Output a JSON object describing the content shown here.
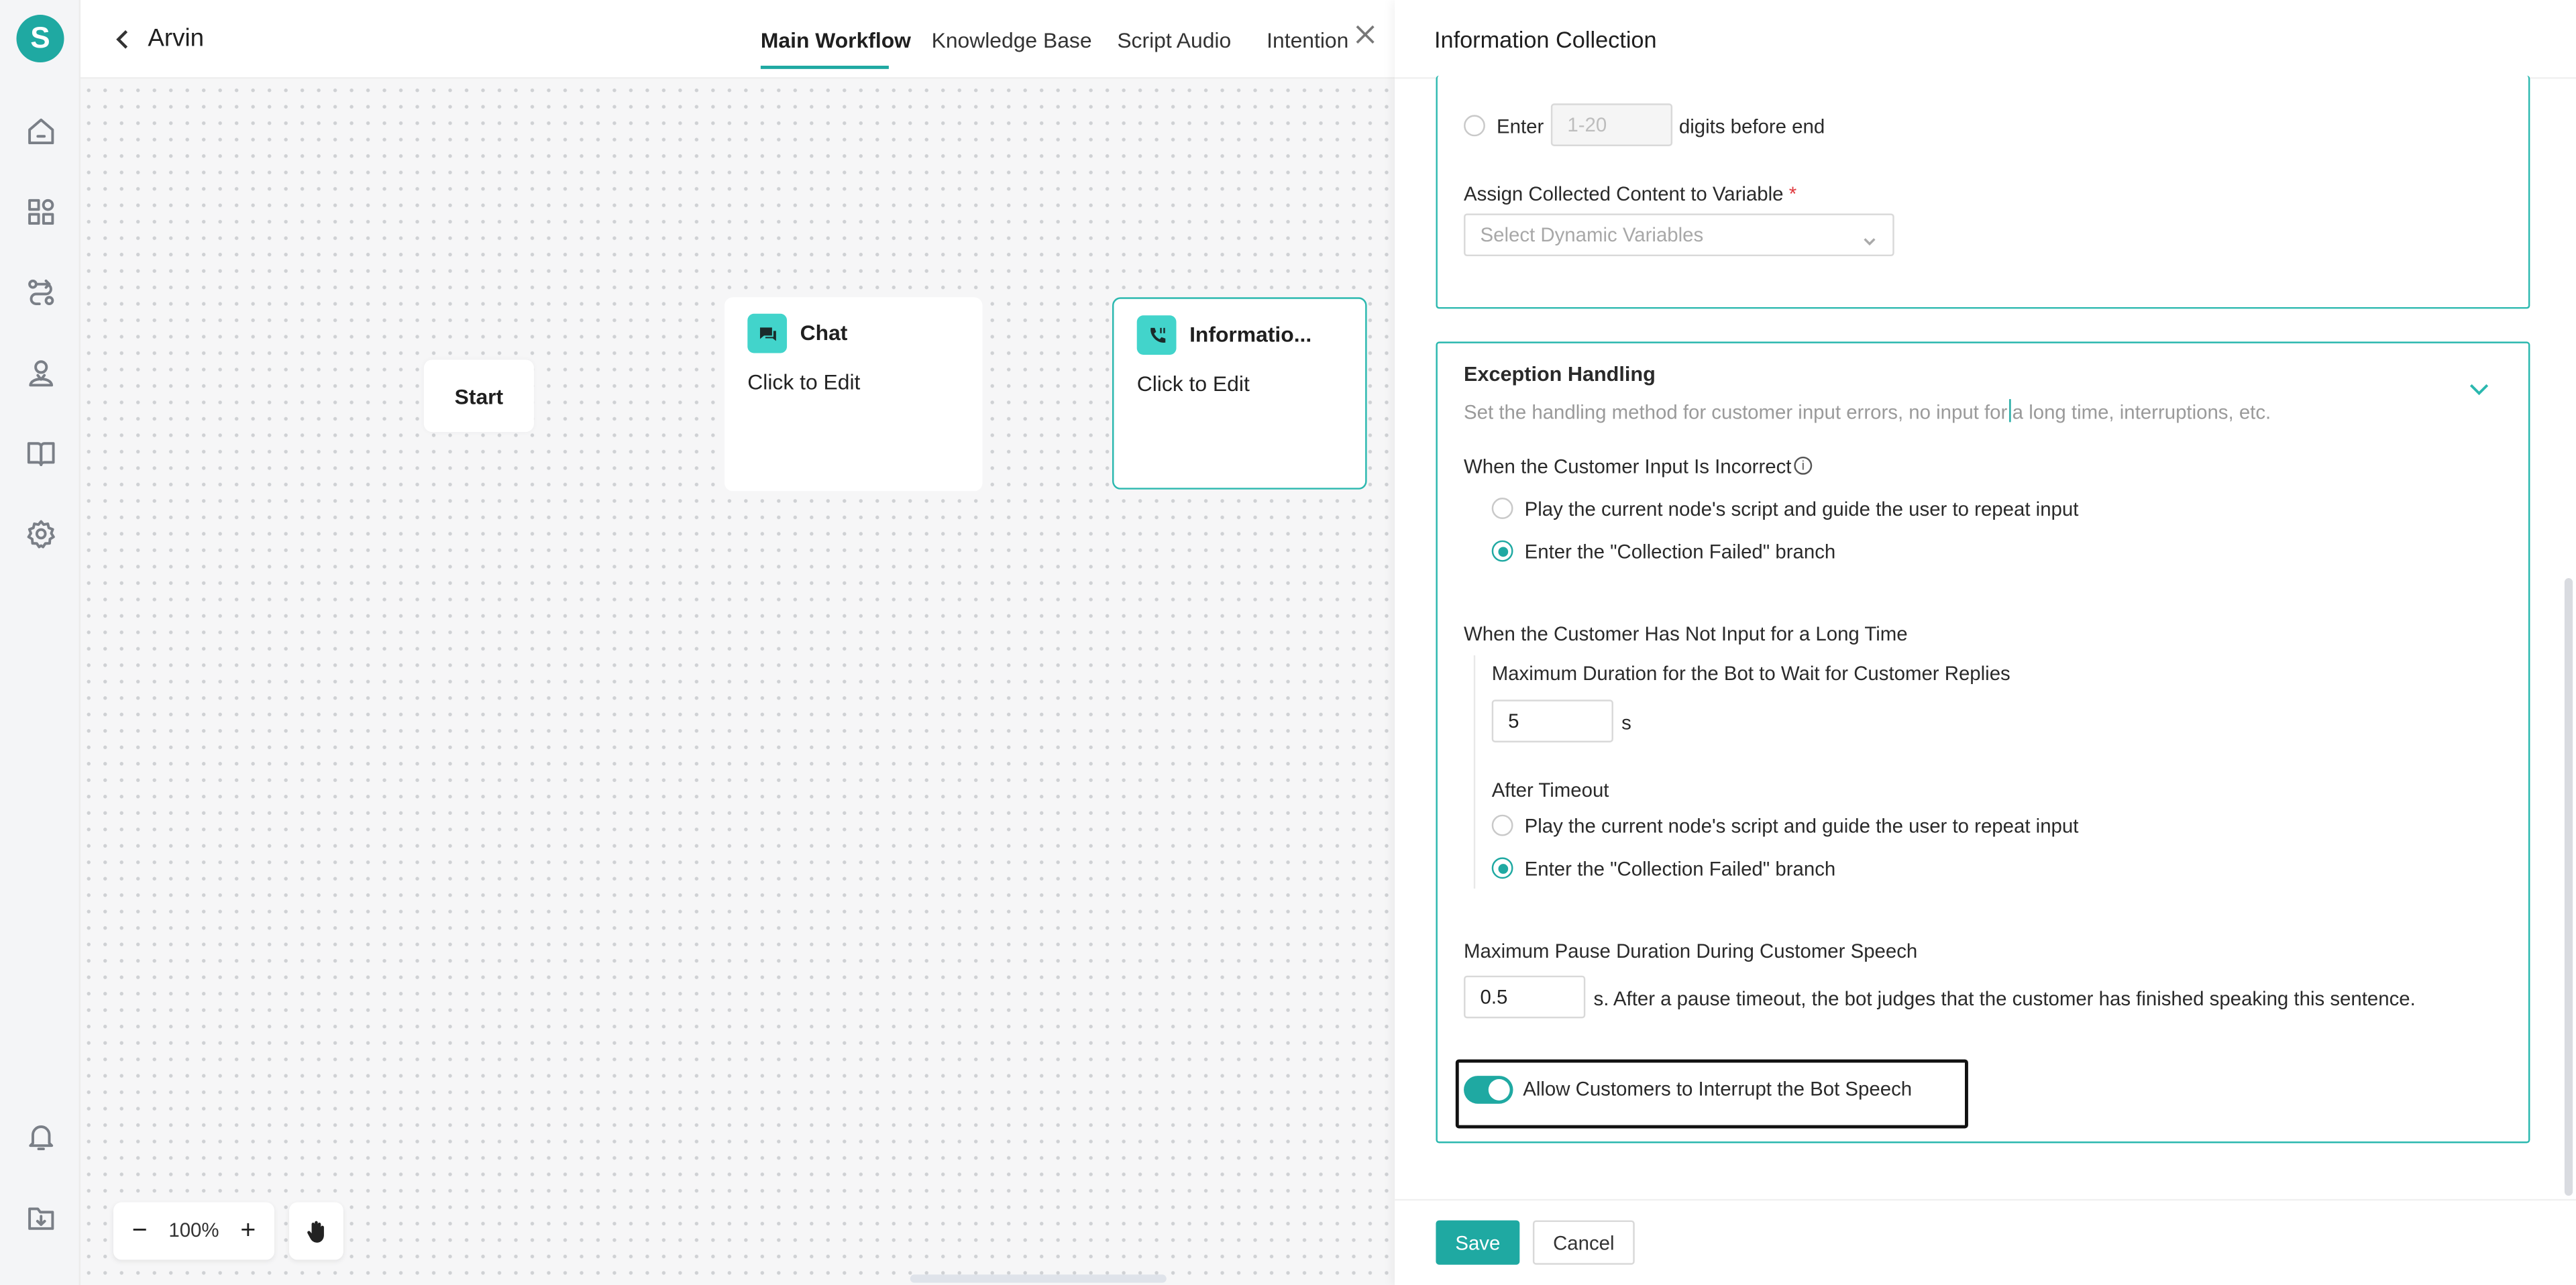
{
  "sidebar": {
    "logo_letter": "S",
    "items": [
      {
        "name": "home-icon"
      },
      {
        "name": "apps-icon"
      },
      {
        "name": "workflow-icon"
      },
      {
        "name": "agent-icon"
      },
      {
        "name": "book-icon"
      },
      {
        "name": "gear-icon"
      }
    ],
    "bottom": [
      {
        "name": "bell-icon"
      },
      {
        "name": "download-icon"
      }
    ]
  },
  "header": {
    "title": "Arvin",
    "tabs": [
      "Main Workflow",
      "Knowledge Base",
      "Script Audio",
      "Intention"
    ],
    "active_tab": "Main Workflow"
  },
  "canvas": {
    "start_label": "Start",
    "nodes": [
      {
        "title": "Chat",
        "subtitle": "Click to Edit",
        "icon": "chat-icon"
      },
      {
        "title": "Informatio...",
        "subtitle": "Click to Edit",
        "icon": "phone-icon"
      }
    ],
    "zoom": "100%",
    "zoom_out": "−",
    "zoom_in": "+"
  },
  "drawer": {
    "title": "Information Collection",
    "top_section": {
      "enter_label": "Enter",
      "digits_placeholder": "1-20",
      "digits_suffix": "digits before end",
      "assign_label": "Assign Collected Content to Variable",
      "required_mark": "*",
      "variable_placeholder": "Select Dynamic Variables"
    },
    "exception": {
      "title": "Exception Handling",
      "description_before": "Set the handling method for customer input errors, no input for",
      "description_after": "a long time, interruptions, etc.",
      "incorrect_label": "When the Customer Input Is Incorrect",
      "incorrect_options": [
        {
          "label": "Play the current node's script and guide the user to repeat input",
          "selected": false
        },
        {
          "label": "Enter the \"Collection Failed\" branch",
          "selected": true
        }
      ],
      "no_input_label": "When the Customer Has Not Input for a Long Time",
      "max_wait_label": "Maximum Duration for the Bot to Wait for Customer Replies",
      "max_wait_value": "5",
      "max_wait_unit": "s",
      "after_timeout_label": "After Timeout",
      "timeout_options": [
        {
          "label": "Play the current node's script and guide the user to repeat input",
          "selected": false
        },
        {
          "label": "Enter the \"Collection Failed\" branch",
          "selected": true
        }
      ],
      "pause_label": "Maximum Pause Duration During Customer Speech",
      "pause_value": "0.5",
      "pause_suffix": "s. After a pause timeout, the bot judges that the customer has finished speaking this sentence.",
      "interrupt_label": "Allow Customers to Interrupt the Bot Speech",
      "interrupt_enabled": true
    },
    "footer": {
      "save": "Save",
      "cancel": "Cancel"
    }
  },
  "colors": {
    "accent": "#1fa9a2",
    "node_icon_bg": "#42d4cb"
  }
}
